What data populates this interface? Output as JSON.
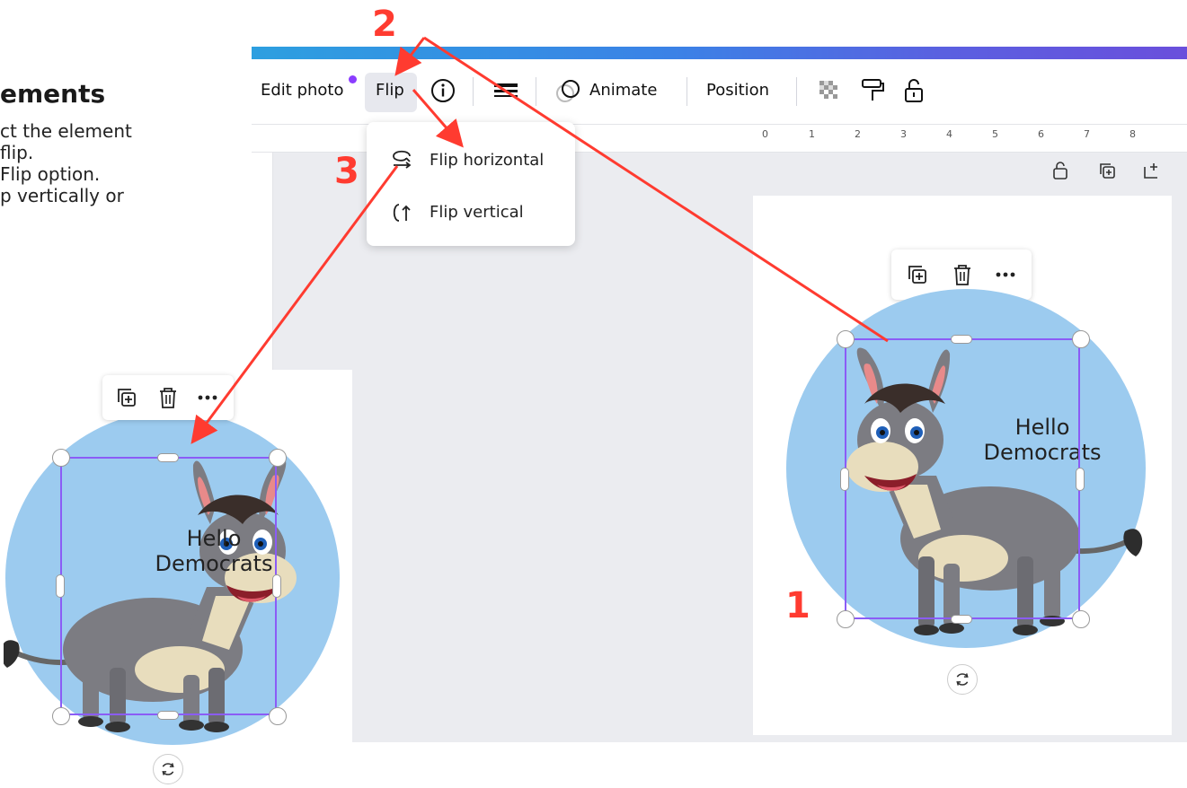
{
  "instructions": {
    "title": "ements",
    "line1": "ct the element",
    "line2": "flip.",
    "line3": "Flip option.",
    "line4": "p vertically or"
  },
  "toolbar": {
    "edit_photo": "Edit photo",
    "flip": "Flip",
    "animate": "Animate",
    "position": "Position"
  },
  "ruler": {
    "numbers": [
      "0",
      "1",
      "2",
      "3",
      "4",
      "5",
      "6",
      "7",
      "8"
    ]
  },
  "flip_menu": {
    "horizontal": "Flip horizontal",
    "vertical": "Flip vertical"
  },
  "canvas": {
    "text_line1": "Hello",
    "text_line2": "Democrats"
  },
  "flipped": {
    "text_line1": "Hello",
    "text_line2": "Democrats"
  },
  "steps": {
    "one": "1",
    "two": "2",
    "three": "3"
  },
  "colors": {
    "accent": "#8b5cf6",
    "circle": "#9ccbef",
    "annotation": "#ff3b30",
    "gradient_start": "#2d9fe0",
    "gradient_end": "#6a4fdc"
  }
}
